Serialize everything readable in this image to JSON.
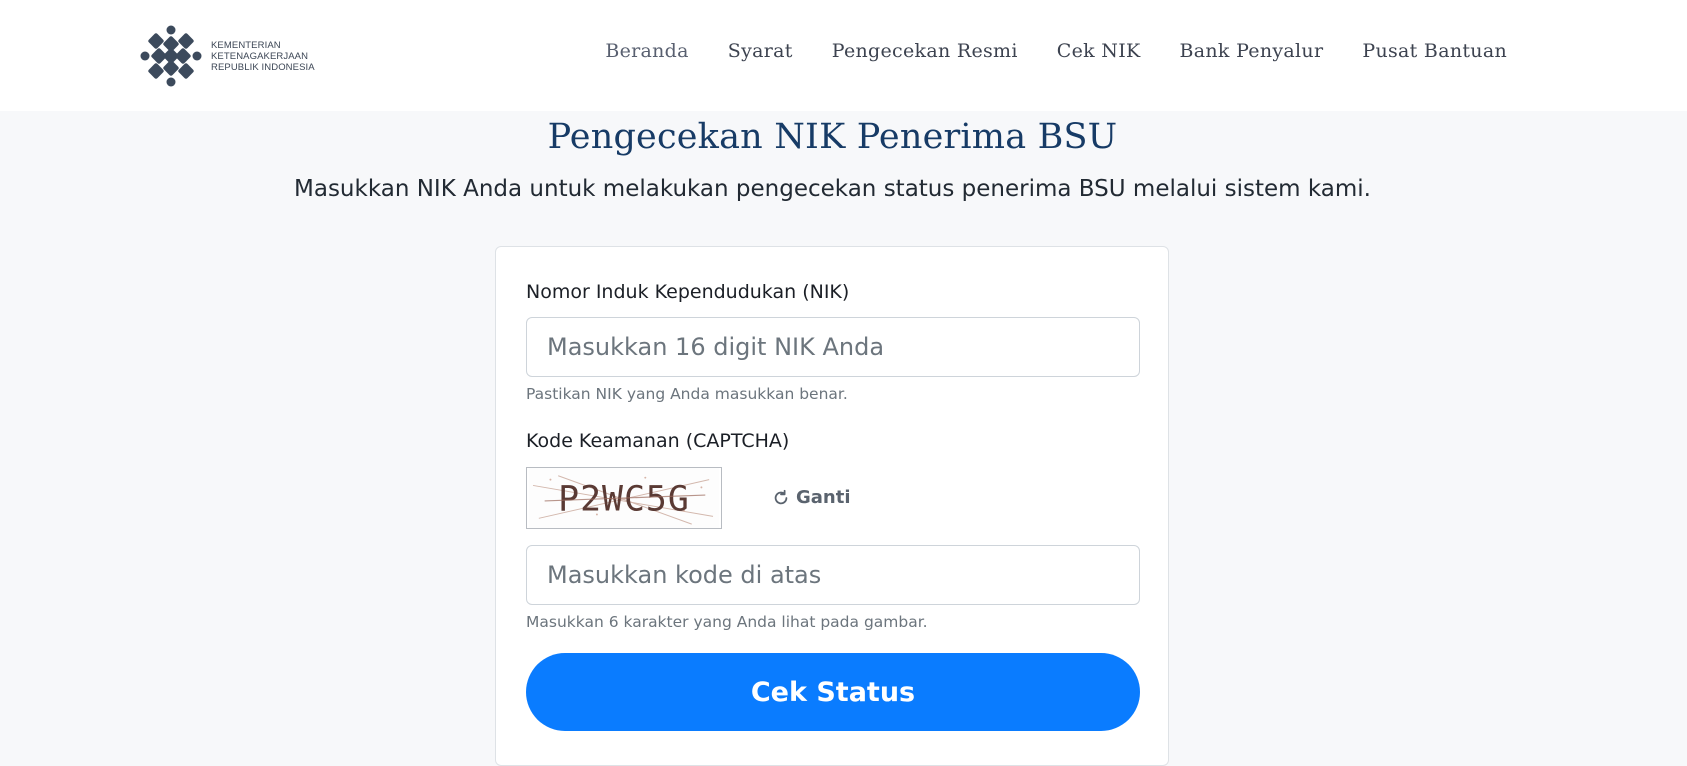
{
  "brand": {
    "logo_icon": "kemnaker-logo-icon",
    "line1": "KEMENTERIAN",
    "line2": "KETENAGAKERJAAN",
    "line3": "REPUBLIK INDONESIA"
  },
  "nav": {
    "items": [
      {
        "label": "Beranda"
      },
      {
        "label": "Syarat"
      },
      {
        "label": "Pengecekan Resmi"
      },
      {
        "label": "Cek NIK"
      },
      {
        "label": "Bank Penyalur"
      },
      {
        "label": "Pusat Bantuan"
      }
    ]
  },
  "page": {
    "title": "Pengecekan NIK Penerima BSU",
    "subtitle": "Masukkan NIK Anda untuk melakukan pengecekan status penerima BSU melalui sistem kami."
  },
  "form": {
    "nik": {
      "label": "Nomor Induk Kependudukan (NIK)",
      "value": "",
      "placeholder": "Masukkan 16 digit NIK Anda",
      "help": "Pastikan NIK yang Anda masukkan benar."
    },
    "captcha": {
      "label": "Kode Keamanan (CAPTCHA)",
      "code": "P2WC5G",
      "refresh_icon": "refresh-icon",
      "refresh_label": "Ganti",
      "value": "",
      "placeholder": "Masukkan kode di atas",
      "help": "Masukkan 6 karakter yang Anda lihat pada gambar."
    },
    "submit_label": "Cek Status"
  },
  "colors": {
    "primary": "#0a7cff",
    "title": "#173b66",
    "background": "#f7f8fa",
    "muted": "#6c757d"
  }
}
